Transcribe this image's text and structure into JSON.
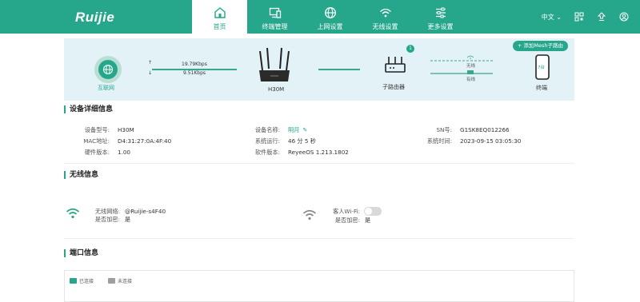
{
  "header": {
    "logo": "Ruijie",
    "nav": [
      {
        "label": "首页",
        "icon": "home-icon",
        "active": true
      },
      {
        "label": "终端管理",
        "icon": "monitor-icon",
        "active": false
      },
      {
        "label": "上网设置",
        "icon": "globe-icon",
        "active": false
      },
      {
        "label": "无线设置",
        "icon": "wifi-icon",
        "active": false
      },
      {
        "label": "更多设置",
        "icon": "sliders-icon",
        "active": false
      }
    ],
    "language": "中文",
    "right_icons": [
      "qrcode-icon",
      "upgrade-icon",
      "user-icon"
    ]
  },
  "topology": {
    "add_button": "添加Mesh子路由",
    "internet_label": "互联网",
    "upload_speed": "19.79Kbps",
    "download_speed": "9.51Kbps",
    "router_label": "H30M",
    "sub_router_label": "子路由器",
    "sub_router_count": "1",
    "wireless_note": "无线",
    "wired_note": "有线",
    "terminal_label": "终端",
    "terminal_count": "7台"
  },
  "device_info": {
    "title": "设备详细信息",
    "model_label": "设备型号:",
    "model": "H30M",
    "name_label": "设备名称:",
    "name": "明月",
    "sn_label": "SN号:",
    "sn": "G1SK8EQ012266",
    "mac_label": "MAC地址:",
    "mac": "D4:31:27:0A:4F:40",
    "uptime_label": "系统运行:",
    "uptime": "46 分 5 秒",
    "systime_label": "系统时间:",
    "systime": "2023-09-15 03:05:30",
    "hw_label": "硬件版本:",
    "hw": "1.00",
    "sw_label": "软件版本:",
    "sw": "ReyeeOS 1.213.1802"
  },
  "wireless": {
    "title": "无线信息",
    "net_label": "无线网络:",
    "net": "@Ruijie-s4F40",
    "enc_label": "是否加密:",
    "enc": "是",
    "guest_label": "客人Wi-Fi:",
    "guest_enabled": false,
    "guest_enc_label": "是否加密:",
    "guest_enc": "是"
  },
  "ports": {
    "title": "端口信息",
    "connected": "已连接",
    "disconnected": "未连接"
  },
  "colors": {
    "brand": "#26a68a",
    "topo_bg": "#e3f2f7"
  }
}
